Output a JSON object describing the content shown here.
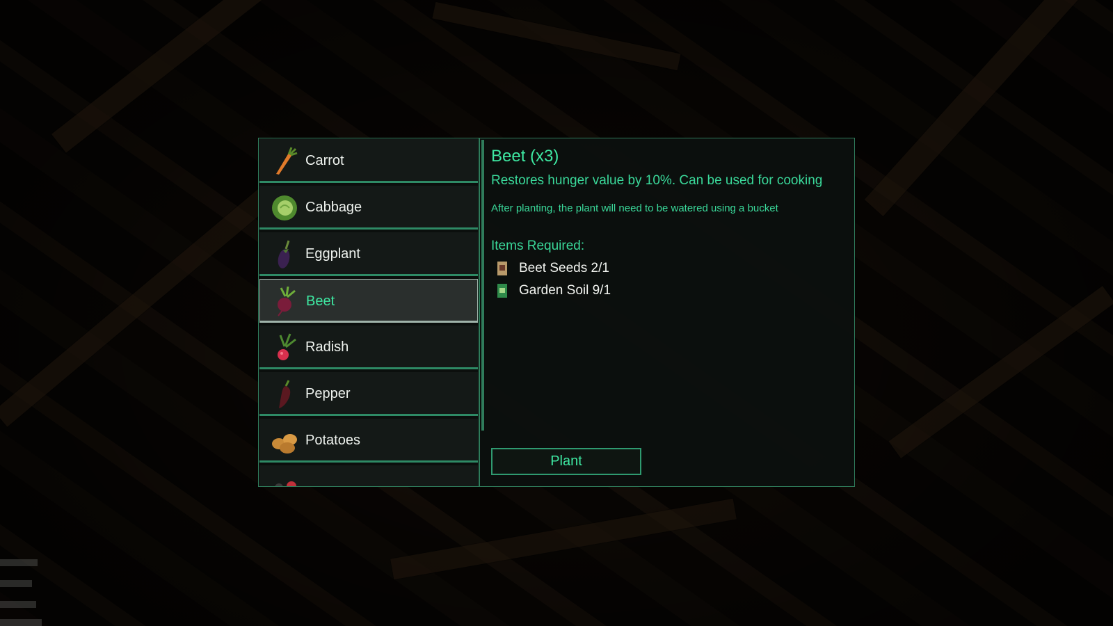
{
  "crop_list": {
    "items": [
      {
        "label": "Carrot",
        "icon": "carrot-icon"
      },
      {
        "label": "Cabbage",
        "icon": "cabbage-icon"
      },
      {
        "label": "Eggplant",
        "icon": "eggplant-icon"
      },
      {
        "label": "Beet",
        "icon": "beet-icon",
        "selected": true
      },
      {
        "label": "Radish",
        "icon": "radish-icon"
      },
      {
        "label": "Pepper",
        "icon": "pepper-icon"
      },
      {
        "label": "Potatoes",
        "icon": "potatoes-icon"
      },
      {
        "label": "",
        "icon": "berries-icon"
      }
    ]
  },
  "detail": {
    "title": "Beet (x3)",
    "description": "Restores hunger value by 10%. Can be used for cooking",
    "note": "After planting, the plant will need to be watered using a bucket",
    "requirements_heading": "Items Required:",
    "requirements": [
      {
        "label": "Beet Seeds 2/1",
        "icon": "seed-packet-icon"
      },
      {
        "label": "Garden Soil 9/1",
        "icon": "soil-bag-icon"
      }
    ],
    "plant_button": "Plant"
  },
  "colors": {
    "accent": "#3ee8a2",
    "border": "#2f7c5b",
    "panel_bg": "#0c100e"
  }
}
